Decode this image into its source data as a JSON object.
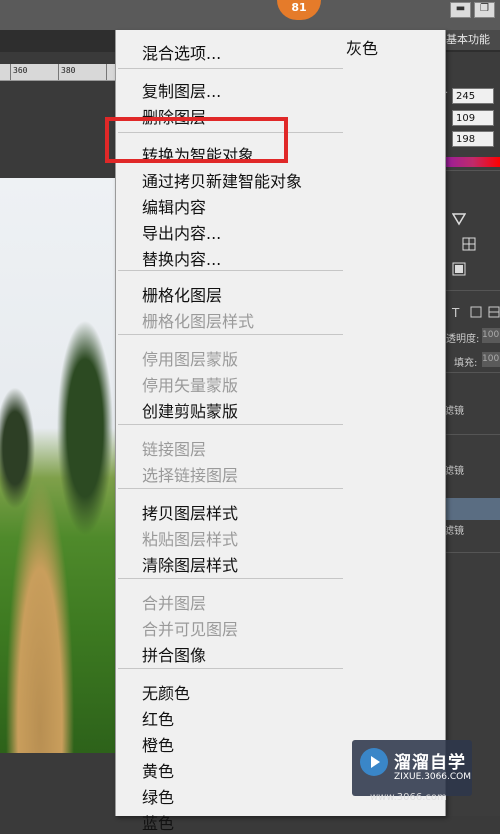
{
  "topbar": {
    "badge": "81",
    "minimize": "▬",
    "restore": "❐"
  },
  "workspace": {
    "label": "基本功能"
  },
  "ruler": {
    "ticks": [
      "360",
      "380"
    ]
  },
  "color_panel": {
    "r": "245",
    "g": "109",
    "b": "198"
  },
  "layers_panel": {
    "opacity_label": "透明度:",
    "opacity_value": "100",
    "fill_label": "填充:",
    "fill_value": "100",
    "row_label": "滤镜"
  },
  "context_menu": {
    "color_label_header": "灰色",
    "groups": [
      [
        {
          "label": "混合选项...",
          "enabled": true
        }
      ],
      [
        {
          "label": "复制图层...",
          "enabled": true
        },
        {
          "label": "删除图层",
          "enabled": true
        }
      ],
      [
        {
          "label": "转换为智能对象",
          "enabled": true,
          "highlighted": true
        },
        {
          "label": "通过拷贝新建智能对象",
          "enabled": true
        },
        {
          "label": "编辑内容",
          "enabled": true
        },
        {
          "label": "导出内容...",
          "enabled": true
        },
        {
          "label": "替换内容...",
          "enabled": true
        }
      ],
      [
        {
          "label": "栅格化图层",
          "enabled": true
        },
        {
          "label": "栅格化图层样式",
          "enabled": false
        }
      ],
      [
        {
          "label": "停用图层蒙版",
          "enabled": false
        },
        {
          "label": "停用矢量蒙版",
          "enabled": false
        },
        {
          "label": "创建剪贴蒙版",
          "enabled": true
        }
      ],
      [
        {
          "label": "链接图层",
          "enabled": false
        },
        {
          "label": "选择链接图层",
          "enabled": false
        }
      ],
      [
        {
          "label": "拷贝图层样式",
          "enabled": true
        },
        {
          "label": "粘贴图层样式",
          "enabled": false
        },
        {
          "label": "清除图层样式",
          "enabled": true
        }
      ],
      [
        {
          "label": "合并图层",
          "enabled": false
        },
        {
          "label": "合并可见图层",
          "enabled": false
        },
        {
          "label": "拼合图像",
          "enabled": true
        }
      ],
      [
        {
          "label": "无颜色",
          "enabled": true
        },
        {
          "label": "红色",
          "enabled": true
        },
        {
          "label": "橙色",
          "enabled": true
        },
        {
          "label": "黄色",
          "enabled": true
        },
        {
          "label": "绿色",
          "enabled": true
        },
        {
          "label": "蓝色",
          "enabled": true
        }
      ]
    ]
  },
  "colors": {
    "highlight_box": "#e02828",
    "badge": "#e57b2a"
  },
  "watermark": {
    "title": "溜溜自学",
    "url": "ZIXUE.3066.COM",
    "url2": "www.3066.com"
  }
}
